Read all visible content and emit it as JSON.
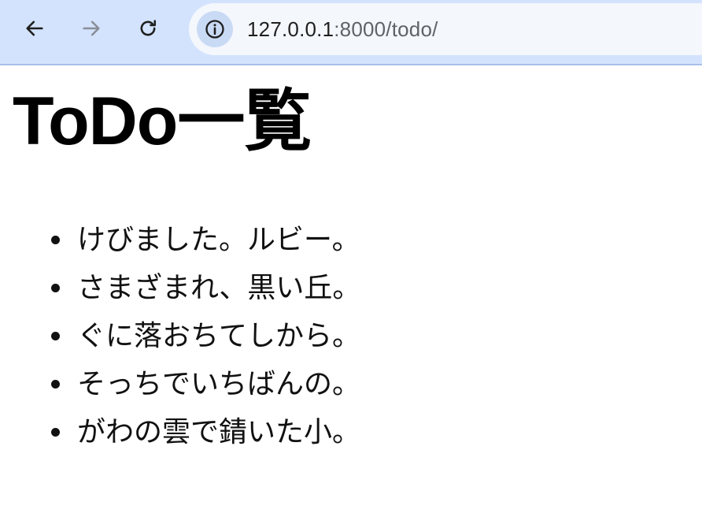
{
  "browser": {
    "url_host": "127.0.0.1",
    "url_rest": ":8000/todo/",
    "icons": {
      "back": "back-arrow-icon",
      "forward": "forward-arrow-icon",
      "reload": "reload-icon",
      "info": "info-icon"
    }
  },
  "page": {
    "title": "ToDo一覧",
    "items": [
      "けびました。ルビー。",
      "さまざまれ、黒い丘。",
      "ぐに落おちてしから。",
      "そっちでいちばんの。",
      "がわの雲で錆いた小。"
    ]
  },
  "colors": {
    "toolbar_bg": "#d3e3fd",
    "omnibox_bg": "#f4f7fc",
    "text": "#111111"
  }
}
